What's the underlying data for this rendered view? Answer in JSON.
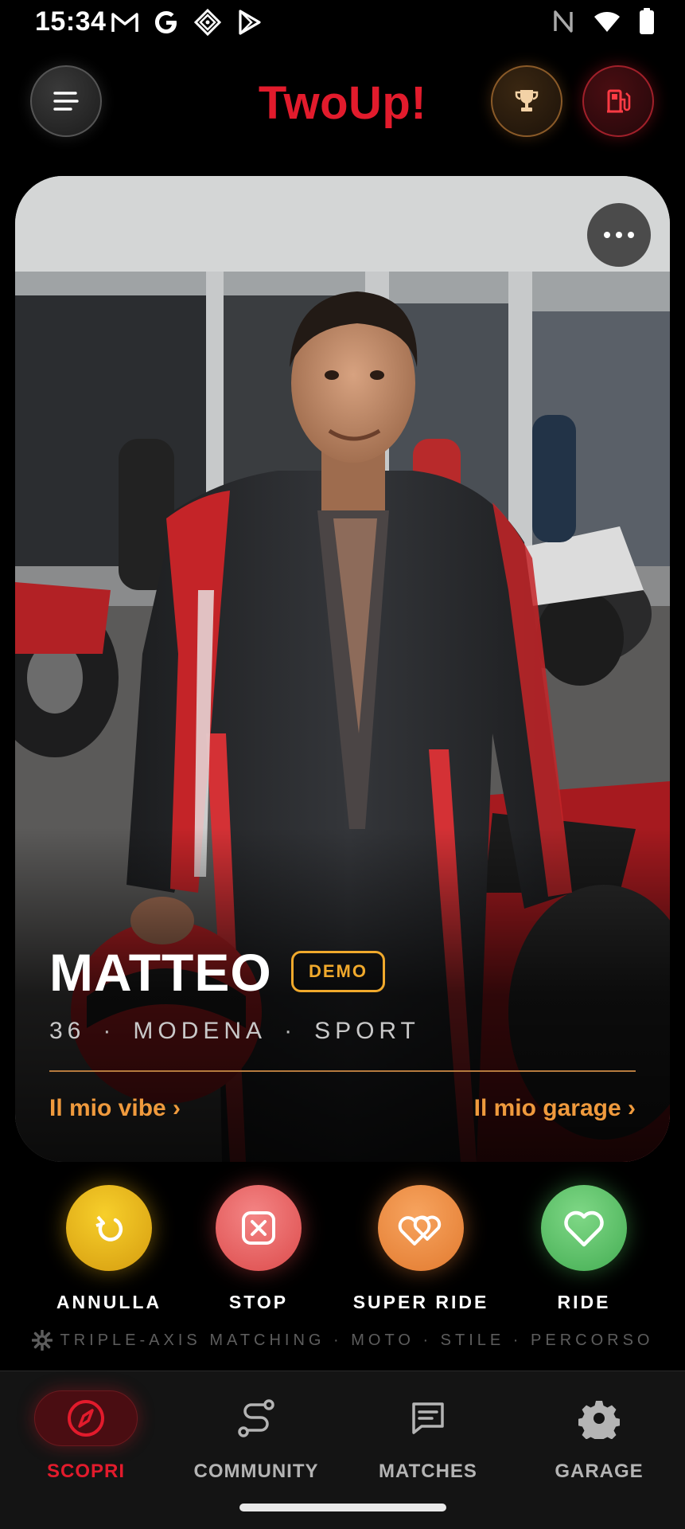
{
  "status_bar": {
    "time": "15:34",
    "left_icons": [
      "gmail-icon",
      "google-icon",
      "gemini-icon",
      "play-store-icon"
    ],
    "right_icons": [
      "nfc-icon",
      "wifi-icon",
      "battery-icon"
    ]
  },
  "header": {
    "title": "TwoUp!",
    "left_button_icon": "menu-icon",
    "right_buttons": [
      "trophy-icon",
      "fuel-pump-icon"
    ]
  },
  "profile": {
    "name": "MATTEO",
    "badge": "DEMO",
    "age": "36",
    "city": "MODENA",
    "style": "SPORT",
    "link_vibe": "Il mio vibe ›",
    "link_garage": "Il mio garage ›",
    "more_icon": "more-horizontal-icon",
    "photo_description_icon": "profile-photo"
  },
  "actions": [
    {
      "label": "ANNULLA",
      "icon": "undo-icon",
      "color": "#f2c11d"
    },
    {
      "label": "STOP",
      "icon": "close-box-icon",
      "color": "#e85b5b"
    },
    {
      "label": "SUPER RIDE",
      "icon": "double-heart-icon",
      "color": "#f08c3e"
    },
    {
      "label": "RIDE",
      "icon": "heart-icon",
      "color": "#4fba5d"
    }
  ],
  "tagline": "TRIPLE-AXIS MATCHING · MOTO · STILE · PERCORSO",
  "bottom_nav": [
    {
      "label": "SCOPRI",
      "icon": "compass-icon",
      "active": true
    },
    {
      "label": "COMMUNITY",
      "icon": "route-icon",
      "active": false
    },
    {
      "label": "MATCHES",
      "icon": "chat-icon",
      "active": false
    },
    {
      "label": "GARAGE",
      "icon": "gear-icon",
      "active": false
    }
  ],
  "colors": {
    "brand_red": "#e21b2c",
    "accent_orange": "#ef9a3d",
    "badge_gold": "#f0a92c"
  }
}
